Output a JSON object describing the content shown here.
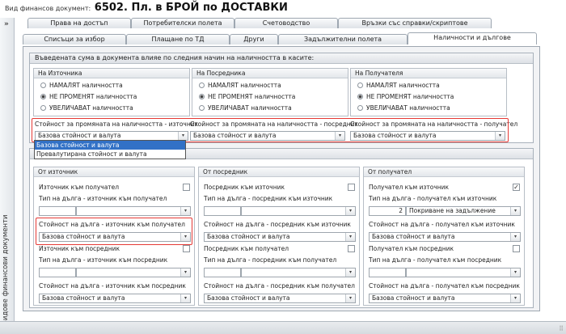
{
  "header": {
    "doc_type_label": "Вид финансов документ:",
    "doc_title": "6502. Пл. в БРОЙ по ДОСТАВКИ"
  },
  "sidebar": {
    "label": "Видове финансови документи"
  },
  "tabs": {
    "row1": [
      "Права на достъп",
      "Потребителски полета",
      "Счетоводство",
      "Връзки със справки/скриптове"
    ],
    "row2": [
      "Списъци за избор",
      "Плащане по ТД",
      "Други",
      "Задължителни полета",
      "Наличности и дългове"
    ],
    "active": "Наличности и дългове"
  },
  "stock": {
    "title": "Въведената сума в документа влияе по следния начин на наличността в касите:",
    "options": [
      "НАМАЛЯТ наличността",
      "НЕ ПРОМЕНЯТ наличността",
      "УВЕЛИЧАВАТ наличността"
    ],
    "source": {
      "title": "На Източника",
      "change_label": "Стойност за промяната на наличността - източник",
      "value": "Базова стойност и валута"
    },
    "mediator": {
      "title": "На Посредника",
      "change_label": "Стойност за промяната на наличността - посредник",
      "value": "Базова стойност и валута"
    },
    "receiver": {
      "title": "На Получателя",
      "change_label": "Стойност за промяната на наличността - получател",
      "value": "Базова стойност и валута"
    },
    "dropdown_options": [
      "Базова стойност и валута",
      "Превалутирана стойност и валута"
    ]
  },
  "debt": {
    "from_source": {
      "title": "От източник",
      "cb1": "Източник към получател",
      "type1": "Тип на дълга - източник към получател",
      "val1_label": "Стойност на дълга - източник към получател",
      "val1": "Базова стойност и валута",
      "cb2": "Източник към посредник",
      "type2": "Тип на дълга - източник към посредник",
      "val2_label": "Стойност на дълга - източник към посредник",
      "val2": "Базова стойност и валута"
    },
    "from_mediator": {
      "title": "От посредник",
      "cb1": "Посредник към източник",
      "type1": "Тип на дълга - посредник към източник",
      "val1_label": "Стойност на дълга - посредник към източник",
      "val1": "Базова стойност и валута",
      "cb2": "Посредник към получател",
      "type2": "Тип на дълга - посредник към получател",
      "val2_label": "Стойност на дълга - посредник към получател",
      "val2": "Базова стойност и валута"
    },
    "from_receiver": {
      "title": "От получател",
      "cb1": "Получател към източник",
      "type1": "Тип на дълга - получател към източник",
      "type1_code": "2",
      "type1_value": "Покриване на задължение",
      "val1_label": "Стойност на дълга - получател към източник",
      "val1": "Базова стойност и валута",
      "cb2": "Получател към посредник",
      "type2": "Тип на дълга - получател към посредник",
      "val2_label": "Стойност на дълга - получател към посредник",
      "val2": "Базова стойност и валута"
    }
  },
  "icons": {
    "check": "✓",
    "dropdown": "▾",
    "collapse": "»",
    "grip": "⠿"
  },
  "colors": {
    "highlight": "#e53935",
    "selection": "#3271c6"
  }
}
